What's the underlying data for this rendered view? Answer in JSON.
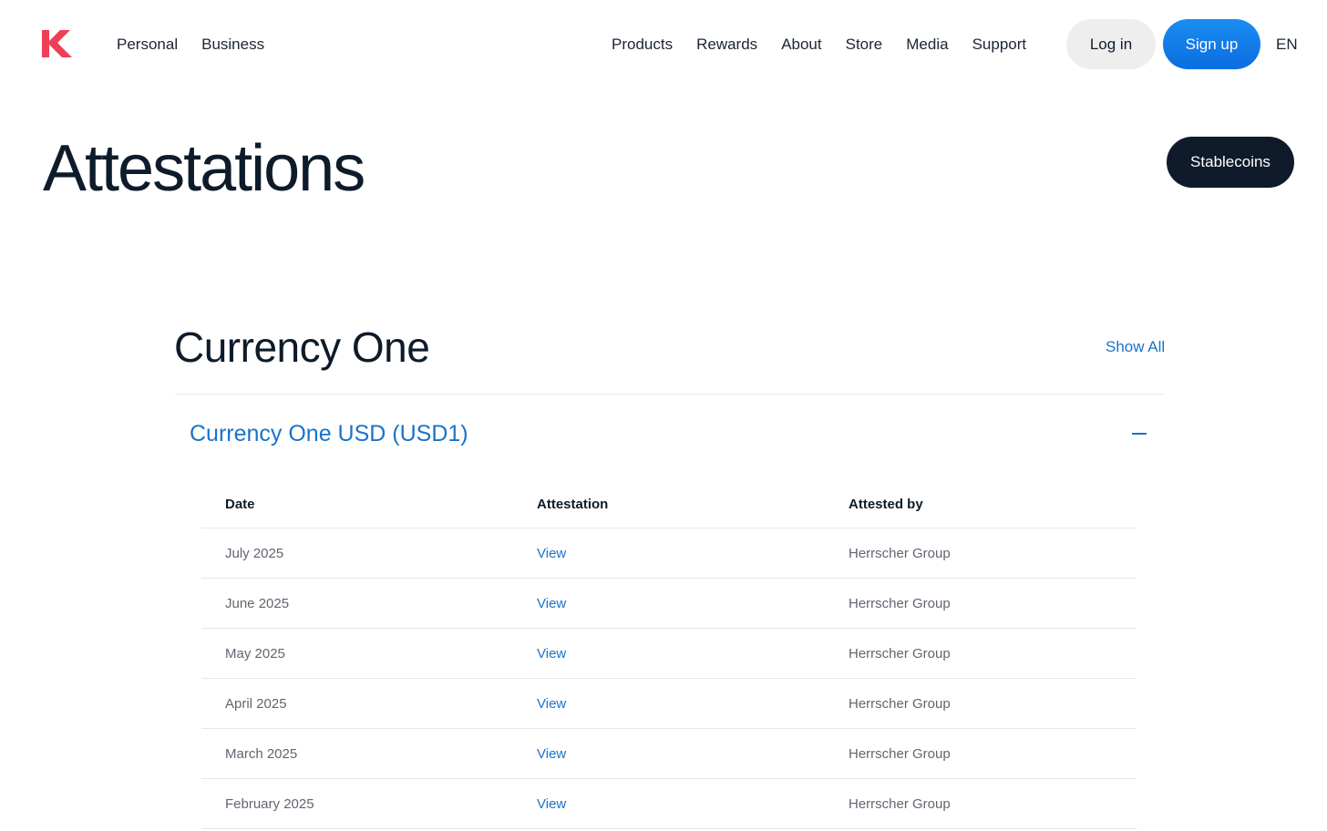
{
  "brand": {
    "accent": "#ef3e55",
    "link_color": "#1a73c8",
    "dark": "#0f1b2b"
  },
  "header": {
    "nav_left": [
      "Personal",
      "Business"
    ],
    "nav_right": [
      "Products",
      "Rewards",
      "About",
      "Store",
      "Media",
      "Support"
    ],
    "login_label": "Log in",
    "signup_label": "Sign up",
    "language": "EN"
  },
  "hero": {
    "title": "Attestations",
    "stablecoins_label": "Stablecoins"
  },
  "section": {
    "title": "Currency One",
    "show_all_label": "Show All",
    "accordion": {
      "title": "Currency One USD (USD1)",
      "expanded": true
    },
    "table": {
      "headers": [
        "Date",
        "Attestation",
        "Attested by"
      ],
      "rows": [
        {
          "date": "July 2025",
          "attestation": "View",
          "attested_by": "Herrscher Group"
        },
        {
          "date": "June 2025",
          "attestation": "View",
          "attested_by": "Herrscher Group"
        },
        {
          "date": "May 2025",
          "attestation": "View",
          "attested_by": "Herrscher Group"
        },
        {
          "date": "April 2025",
          "attestation": "View",
          "attested_by": "Herrscher Group"
        },
        {
          "date": "March 2025",
          "attestation": "View",
          "attested_by": "Herrscher Group"
        },
        {
          "date": "February 2025",
          "attestation": "View",
          "attested_by": "Herrscher Group"
        }
      ]
    }
  }
}
